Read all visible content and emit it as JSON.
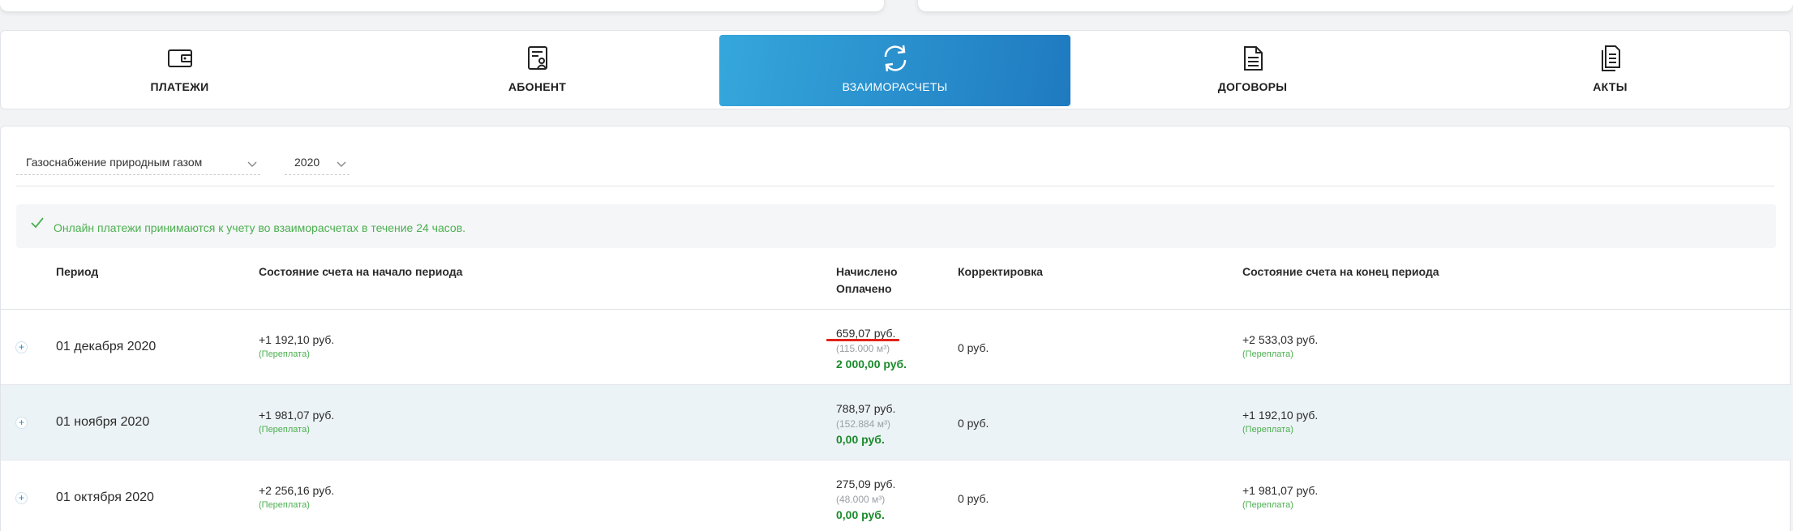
{
  "tabs": [
    {
      "label": "ПЛАТЕЖИ",
      "icon": "wallet-icon",
      "active": false
    },
    {
      "label": "АБОНЕНТ",
      "icon": "user-document-icon",
      "active": false
    },
    {
      "label": "ВЗАИМОРАСЧЕТЫ",
      "icon": "refresh-icon",
      "active": true
    },
    {
      "label": "ДОГОВОРЫ",
      "icon": "contract-icon",
      "active": false
    },
    {
      "label": "АКТЫ",
      "icon": "acts-icon",
      "active": false
    }
  ],
  "filters": {
    "service": "Газоснабжение природным газом",
    "year": "2020"
  },
  "notice": "Онлайн платежи принимаются к учету во взаиморасчетах в течение 24 часов.",
  "columns": {
    "period": "Период",
    "start_balance": "Состояние счета на начало периода",
    "charged": "Начислено",
    "paid": "Оплачено",
    "correction": "Корректировка",
    "end_balance": "Состояние счета на конец периода"
  },
  "rows": [
    {
      "period": "01 декабря 2020",
      "start": "+1 192,10 руб.",
      "start_note": "(Переплата)",
      "charged": "659,07 руб.",
      "volume": "(115.000 м³)",
      "paid": "2 000,00 руб.",
      "correction": "0 руб.",
      "end": "+2 533,03 руб.",
      "end_note": "(Переплата)"
    },
    {
      "period": "01 ноября 2020",
      "start": "+1 981,07 руб.",
      "start_note": "(Переплата)",
      "charged": "788,97 руб.",
      "volume": "(152.884 м³)",
      "paid": "0,00 руб.",
      "correction": "0 руб.",
      "end": "+1 192,10 руб.",
      "end_note": "(Переплата)"
    },
    {
      "period": "01 октября 2020",
      "start": "+2 256,16 руб.",
      "start_note": "(Переплата)",
      "charged": "275,09 руб.",
      "volume": "(48.000 м³)",
      "paid": "0,00 руб.",
      "correction": "0 руб.",
      "end": "+1 981,07 руб.",
      "end_note": "(Переплата)"
    }
  ],
  "colors": {
    "accent": "#1f7ac0",
    "accent_light": "#35a7db",
    "success": "#4caf50",
    "paid": "#1a8a2a",
    "highlight": "#e2231a"
  }
}
